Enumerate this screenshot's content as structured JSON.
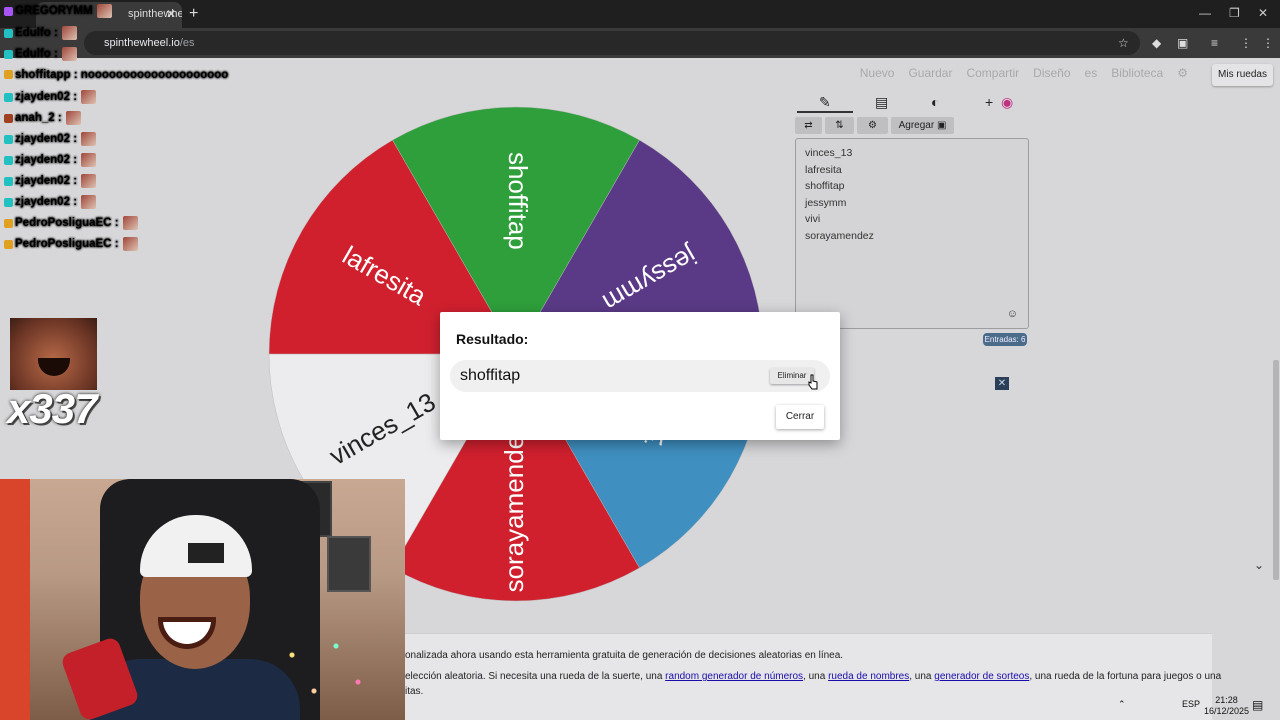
{
  "browser": {
    "tab_title": "spinthewheel.io",
    "tab_close": "✕",
    "new_tab": "+",
    "url_host": "spinthewheel.io",
    "url_path": "/es"
  },
  "page": {
    "nav": [
      "Nuevo",
      "Guardar",
      "Compartir",
      "Diseño",
      "es"
    ],
    "library": "Biblioteca",
    "my_wheels": "Mis ruedas"
  },
  "wheel": {
    "segments": [
      {
        "label": "vinces_13",
        "color": "#ececee"
      },
      {
        "label": "lafresita",
        "color": "#d0202e"
      },
      {
        "label": "shoffitap",
        "color": "#2e9f3b"
      },
      {
        "label": "jessymm",
        "color": "#5a3a86"
      },
      {
        "label": "vivi",
        "color": "#3f8fc0"
      },
      {
        "label": "sorayamendez",
        "color": "#d0202e"
      }
    ]
  },
  "panel": {
    "add_button": "Agregar",
    "entries": [
      "vinces_13",
      "lafresita",
      "shoffitap",
      "jessymm",
      "vivi",
      "sorayamendez"
    ],
    "entries_count": "Entradas: 6"
  },
  "modal": {
    "title": "Resultado:",
    "winner": "shoffitap",
    "remove_button": "Eliminar",
    "close_button": "Cerrar"
  },
  "footer": {
    "line1": "onalizada ahora usando esta herramienta gratuita de generación de decisiones aleatorias en línea.",
    "line2_pre": "elección aleatoria. Si necesita una rueda de la suerte, una ",
    "link1": "random generador de números",
    "line2_mid1": ", una ",
    "link2": "rueda de nombres",
    "line2_mid2": ", una ",
    "link3": "generador de sorteos",
    "line2_post": ", una rueda de la fortuna para juegos o una",
    "line3": "itas."
  },
  "stream": {
    "chat": [
      {
        "user": "GREGORYMM",
        "msg": "",
        "color": "#4cf05a"
      },
      {
        "user": "Edulfo",
        "msg": ":",
        "color": "#5ee08a"
      },
      {
        "user": "Edulfo",
        "msg": ":",
        "color": "#5ee08a"
      },
      {
        "user": "shoffitapp",
        "msg": ": noooooooooooooooooooo",
        "color": "#e6e6e6"
      },
      {
        "user": "zjayden02",
        "msg": ":",
        "color": "#3b8ef0"
      },
      {
        "user": "anah_2",
        "msg": ":",
        "color": "#5fb07a"
      },
      {
        "user": "zjayden02",
        "msg": ":",
        "color": "#3b8ef0"
      },
      {
        "user": "zjayden02",
        "msg": ":",
        "color": "#3b8ef0"
      },
      {
        "user": "zjayden02",
        "msg": ":",
        "color": "#3b8ef0"
      },
      {
        "user": "zjayden02",
        "msg": ":",
        "color": "#3b8ef0"
      },
      {
        "user": "PedroPosliguaEC",
        "msg": ":",
        "color": "#9ef04a"
      },
      {
        "user": "PedroPosliguaEC",
        "msg": ":",
        "color": "#9ef04a"
      }
    ],
    "combo": "x337"
  },
  "taskbar": {
    "lang": "ESP",
    "time": "21:28",
    "date": "16/12/2025"
  }
}
